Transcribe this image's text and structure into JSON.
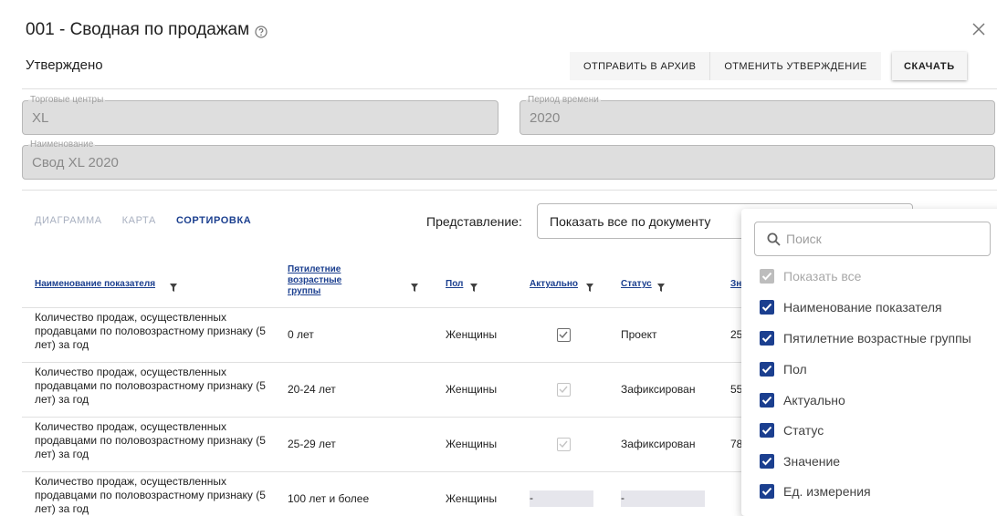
{
  "dialog": {
    "title": "001 - Сводная по продажам",
    "status": "Утверждено"
  },
  "toolbar": {
    "archive_label": "ОТПРАВИТЬ В АРХИВ",
    "cancel_label": "ОТМЕНИТЬ УТВЕРЖДЕНИЕ",
    "download_label": "СКАЧАТЬ"
  },
  "fields": {
    "malls": {
      "label": "Торговые центры",
      "value": "XL"
    },
    "period": {
      "label": "Период времени",
      "value": "2020"
    },
    "name": {
      "label": "Наименование",
      "value": "Свод XL 2020"
    }
  },
  "tabs": [
    "ДИАГРАММА",
    "КАРТА",
    "СОРТИРОВКА"
  ],
  "active_tab": "СОРТИРОВКА",
  "representation": {
    "label": "Представление:",
    "value": "Показать все по документу"
  },
  "table": {
    "columns": [
      "Наименование показателя",
      "Пятилетние возрастные группы",
      "Пол",
      "Актуально",
      "Статус",
      "Зн"
    ],
    "rows": [
      {
        "name": "Количество продаж, осуществленных продавцами по половозрастному признаку (5 лет) за год",
        "age": "0 лет",
        "sex": "Женщины",
        "actual": true,
        "status": "Проект",
        "value": "25"
      },
      {
        "name": "Количество продаж, осуществленных продавцами по половозрастному признаку (5 лет) за год",
        "age": "20-24 лет",
        "sex": "Женщины",
        "actual": true,
        "status": "Зафиксирован",
        "value": "55"
      },
      {
        "name": "Количество продаж, осуществленных продавцами по половозрастному признаку (5 лет) за год",
        "age": "25-29 лет",
        "sex": "Женщины",
        "actual": true,
        "status": "Зафиксирован",
        "value": "78"
      },
      {
        "name": "Количество продаж, осуществленных продавцами по половозрастному признаку (5 лет) за год",
        "age": "100 лет и более",
        "sex": "Женщины",
        "actual": null,
        "status": "",
        "value": ""
      }
    ],
    "empty_mark": "-"
  },
  "column_picker": {
    "search_placeholder": "Поиск",
    "options": [
      {
        "label": "Показать все",
        "checked": true,
        "disabled": true
      },
      {
        "label": "Наименование показателя",
        "checked": true,
        "disabled": false
      },
      {
        "label": "Пятилетние возрастные группы",
        "checked": true,
        "disabled": false
      },
      {
        "label": "Пол",
        "checked": true,
        "disabled": false
      },
      {
        "label": "Актуально",
        "checked": true,
        "disabled": false
      },
      {
        "label": "Статус",
        "checked": true,
        "disabled": false
      },
      {
        "label": "Значение",
        "checked": true,
        "disabled": false
      },
      {
        "label": "Ед. измерения",
        "checked": true,
        "disabled": false
      }
    ]
  },
  "colors": {
    "accent": "#1b3f8f",
    "checkbox_disabled": "#bdbdbd",
    "field_bg": "#dedede"
  }
}
